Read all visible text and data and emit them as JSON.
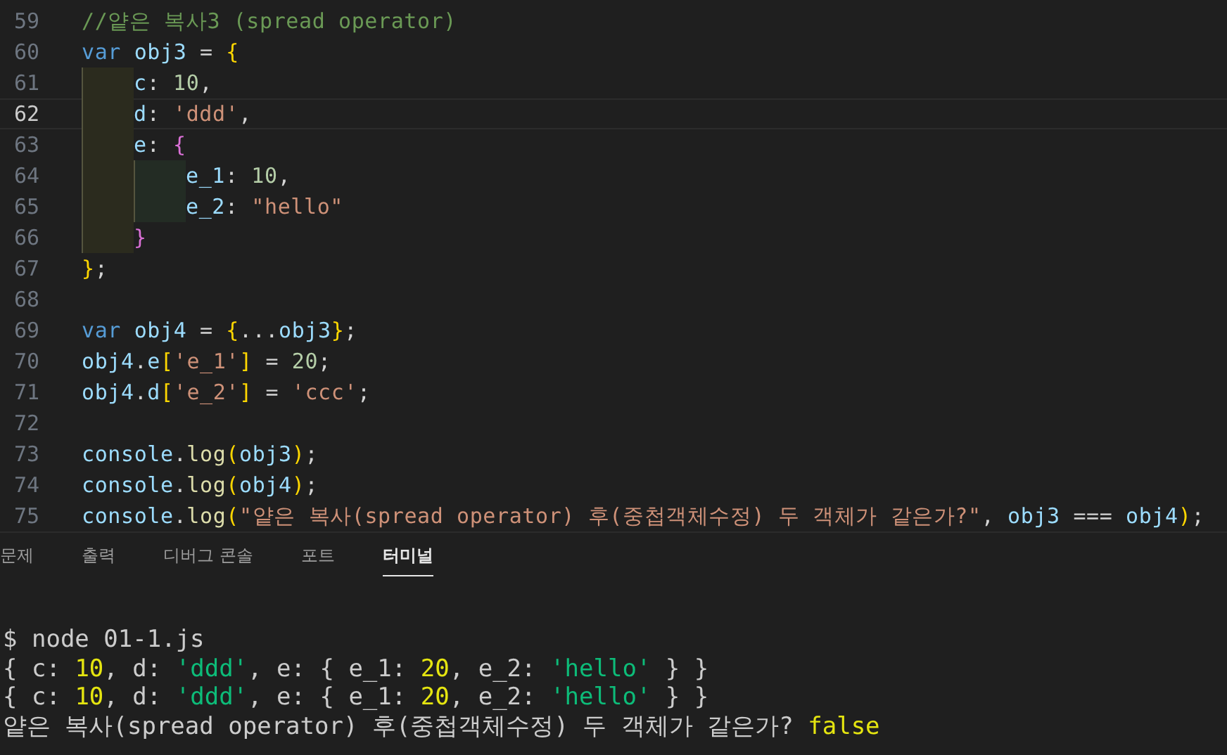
{
  "editor": {
    "lines": [
      {
        "number": "59",
        "active": false,
        "tokens": [
          {
            "text": "//얕은 복사3 (spread operator)",
            "kind": "comment"
          }
        ]
      },
      {
        "number": "60",
        "active": false,
        "tokens": [
          {
            "text": "var",
            "kind": "keyword"
          },
          {
            "text": " obj3",
            "kind": "variable"
          },
          {
            "text": " = ",
            "kind": "plain"
          },
          {
            "text": "{",
            "kind": "brace1"
          }
        ]
      },
      {
        "number": "61",
        "active": false,
        "tokens": [
          {
            "kind": "indent1"
          },
          {
            "text": "c",
            "kind": "variable"
          },
          {
            "text": ": ",
            "kind": "plain"
          },
          {
            "text": "10",
            "kind": "number"
          },
          {
            "text": ",",
            "kind": "plain"
          }
        ]
      },
      {
        "number": "62",
        "active": true,
        "tokens": [
          {
            "kind": "indent1"
          },
          {
            "text": "d",
            "kind": "variable"
          },
          {
            "text": ": ",
            "kind": "plain"
          },
          {
            "text": "'ddd'",
            "kind": "string"
          },
          {
            "text": ",",
            "kind": "plain"
          }
        ]
      },
      {
        "number": "63",
        "active": false,
        "tokens": [
          {
            "kind": "indent1"
          },
          {
            "text": "e",
            "kind": "variable"
          },
          {
            "text": ": ",
            "kind": "plain"
          },
          {
            "text": "{",
            "kind": "brace2"
          }
        ]
      },
      {
        "number": "64",
        "active": false,
        "tokens": [
          {
            "kind": "indent1"
          },
          {
            "kind": "indent2"
          },
          {
            "text": "e_1",
            "kind": "variable"
          },
          {
            "text": ": ",
            "kind": "plain"
          },
          {
            "text": "10",
            "kind": "number"
          },
          {
            "text": ",",
            "kind": "plain"
          }
        ]
      },
      {
        "number": "65",
        "active": false,
        "tokens": [
          {
            "kind": "indent1"
          },
          {
            "kind": "indent2"
          },
          {
            "text": "e_2",
            "kind": "variable"
          },
          {
            "text": ": ",
            "kind": "plain"
          },
          {
            "text": "\"hello\"",
            "kind": "string"
          }
        ]
      },
      {
        "number": "66",
        "active": false,
        "tokens": [
          {
            "kind": "indent1"
          },
          {
            "text": "}",
            "kind": "brace2"
          }
        ]
      },
      {
        "number": "67",
        "active": false,
        "tokens": [
          {
            "text": "}",
            "kind": "brace1"
          },
          {
            "text": ";",
            "kind": "plain"
          }
        ]
      },
      {
        "number": "68",
        "active": false
      },
      {
        "number": "69",
        "active": false,
        "tokens": [
          {
            "text": "var",
            "kind": "keyword"
          },
          {
            "text": " obj4",
            "kind": "variable"
          },
          {
            "text": " = ",
            "kind": "plain"
          },
          {
            "text": "{",
            "kind": "brace1"
          },
          {
            "text": "...",
            "kind": "plain"
          },
          {
            "text": "obj3",
            "kind": "variable"
          },
          {
            "text": "}",
            "kind": "brace1"
          },
          {
            "text": ";",
            "kind": "plain"
          }
        ]
      },
      {
        "number": "70",
        "active": false,
        "tokens": [
          {
            "text": "obj4",
            "kind": "variable"
          },
          {
            "text": ".",
            "kind": "plain"
          },
          {
            "text": "e",
            "kind": "variable"
          },
          {
            "text": "[",
            "kind": "brace1"
          },
          {
            "text": "'e_1'",
            "kind": "string"
          },
          {
            "text": "]",
            "kind": "brace1"
          },
          {
            "text": " = ",
            "kind": "plain"
          },
          {
            "text": "20",
            "kind": "number"
          },
          {
            "text": ";",
            "kind": "plain"
          }
        ]
      },
      {
        "number": "71",
        "active": false,
        "tokens": [
          {
            "text": "obj4",
            "kind": "variable"
          },
          {
            "text": ".",
            "kind": "plain"
          },
          {
            "text": "d",
            "kind": "variable"
          },
          {
            "text": "[",
            "kind": "brace1"
          },
          {
            "text": "'e_2'",
            "kind": "string"
          },
          {
            "text": "]",
            "kind": "brace1"
          },
          {
            "text": " = ",
            "kind": "plain"
          },
          {
            "text": "'ccc'",
            "kind": "string"
          },
          {
            "text": ";",
            "kind": "plain"
          }
        ]
      },
      {
        "number": "72",
        "active": false
      },
      {
        "number": "73",
        "active": false,
        "tokens": [
          {
            "text": "console",
            "kind": "variable"
          },
          {
            "text": ".",
            "kind": "plain"
          },
          {
            "text": "log",
            "kind": "function"
          },
          {
            "text": "(",
            "kind": "brace1"
          },
          {
            "text": "obj3",
            "kind": "variable"
          },
          {
            "text": ")",
            "kind": "brace1"
          },
          {
            "text": ";",
            "kind": "plain"
          }
        ]
      },
      {
        "number": "74",
        "active": false,
        "tokens": [
          {
            "text": "console",
            "kind": "variable"
          },
          {
            "text": ".",
            "kind": "plain"
          },
          {
            "text": "log",
            "kind": "function"
          },
          {
            "text": "(",
            "kind": "brace1"
          },
          {
            "text": "obj4",
            "kind": "variable"
          },
          {
            "text": ")",
            "kind": "brace1"
          },
          {
            "text": ";",
            "kind": "plain"
          }
        ]
      },
      {
        "number": "75",
        "active": false,
        "tokens": [
          {
            "text": "console",
            "kind": "variable"
          },
          {
            "text": ".",
            "kind": "plain"
          },
          {
            "text": "log",
            "kind": "function"
          },
          {
            "text": "(",
            "kind": "brace1"
          },
          {
            "text": "\"얕은 복사(spread operator) 후(중첩객체수정) 두 객체가 같은가?\"",
            "kind": "string"
          },
          {
            "text": ", ",
            "kind": "plain"
          },
          {
            "text": "obj3",
            "kind": "variable"
          },
          {
            "text": " === ",
            "kind": "plain"
          },
          {
            "text": "obj4",
            "kind": "variable"
          },
          {
            "text": ")",
            "kind": "brace1"
          },
          {
            "text": ";",
            "kind": "plain"
          }
        ]
      }
    ]
  },
  "panel": {
    "tabs": [
      {
        "label": "문제",
        "selected": false
      },
      {
        "label": "출력",
        "selected": false
      },
      {
        "label": "디버그 콘솔",
        "selected": false
      },
      {
        "label": "포트",
        "selected": false
      },
      {
        "label": "터미널",
        "selected": true
      }
    ]
  },
  "terminal": {
    "lines": [
      [
        {
          "text": "$ node 01-1.js",
          "kind": "plain"
        }
      ],
      [
        {
          "text": "{ c: ",
          "kind": "plain"
        },
        {
          "text": "10",
          "kind": "number"
        },
        {
          "text": ", d: ",
          "kind": "plain"
        },
        {
          "text": "'ddd'",
          "kind": "string"
        },
        {
          "text": ", e: { e_1: ",
          "kind": "plain"
        },
        {
          "text": "20",
          "kind": "number"
        },
        {
          "text": ", e_2: ",
          "kind": "plain"
        },
        {
          "text": "'hello'",
          "kind": "string"
        },
        {
          "text": " } }",
          "kind": "plain"
        }
      ],
      [
        {
          "text": "{ c: ",
          "kind": "plain"
        },
        {
          "text": "10",
          "kind": "number"
        },
        {
          "text": ", d: ",
          "kind": "plain"
        },
        {
          "text": "'ddd'",
          "kind": "string"
        },
        {
          "text": ", e: { e_1: ",
          "kind": "plain"
        },
        {
          "text": "20",
          "kind": "number"
        },
        {
          "text": ", e_2: ",
          "kind": "plain"
        },
        {
          "text": "'hello'",
          "kind": "string"
        },
        {
          "text": " } }",
          "kind": "plain"
        }
      ],
      [
        {
          "text": "얕은 복사(spread operator) 후(중첩객체수정) 두 객체가 같은가? ",
          "kind": "plain"
        },
        {
          "text": "false",
          "kind": "number"
        }
      ]
    ]
  }
}
